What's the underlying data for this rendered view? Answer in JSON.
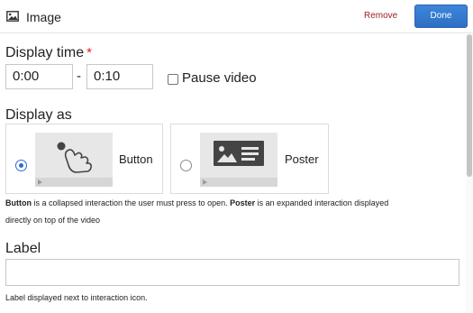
{
  "header": {
    "title": "Image",
    "remove_label": "Remove",
    "done_label": "Done"
  },
  "display_time": {
    "label": "Display time",
    "required_mark": "*",
    "start": "0:00",
    "end": "0:10",
    "separator": "-",
    "pause_label": "Pause video",
    "pause_checked": false
  },
  "display_as": {
    "label": "Display as",
    "options": [
      {
        "label": "Button",
        "selected": true
      },
      {
        "label": "Poster",
        "selected": false
      }
    ],
    "help_bold_1": "Button",
    "help_text_1": " is a collapsed interaction the user must press to open. ",
    "help_bold_2": "Poster",
    "help_text_2": " is an expanded interaction displayed",
    "help_line_2": "directly on top of the video"
  },
  "label_field": {
    "label": "Label",
    "value": "",
    "help": "Label displayed next to interaction icon."
  },
  "colors": {
    "accent": "#2a6ad4",
    "remove": "#a0202a",
    "required": "#dd2222"
  },
  "icons": [
    "image-icon",
    "button-interaction-icon",
    "poster-interaction-icon",
    "play-icon"
  ]
}
